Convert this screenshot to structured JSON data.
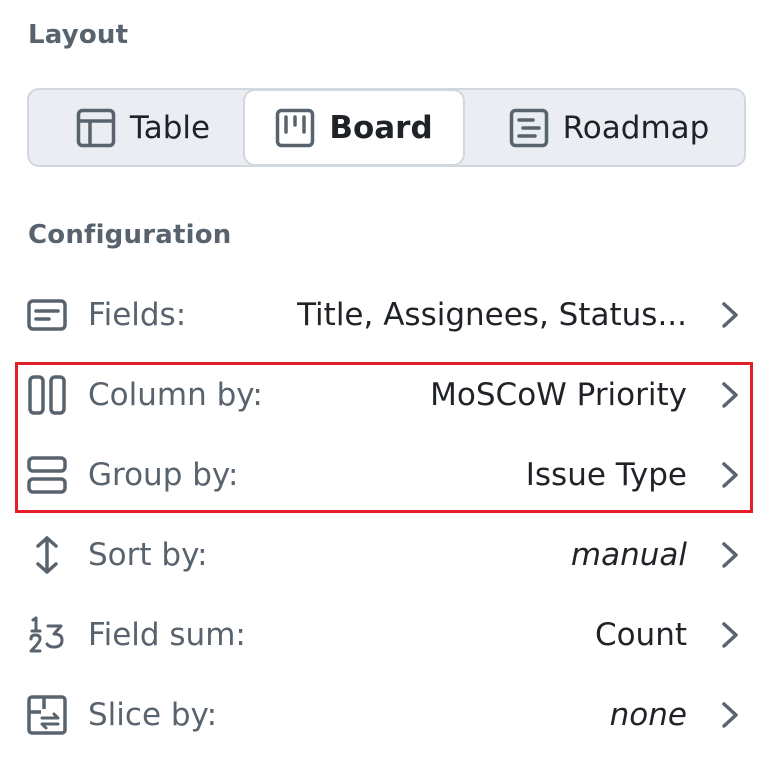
{
  "layout": {
    "title": "Layout",
    "options": [
      {
        "label": "Table",
        "icon": "table-icon",
        "selected": false
      },
      {
        "label": "Board",
        "icon": "board-icon",
        "selected": true
      },
      {
        "label": "Roadmap",
        "icon": "roadmap-icon",
        "selected": false
      }
    ]
  },
  "configuration": {
    "title": "Configuration",
    "rows": [
      {
        "label": "Fields:",
        "value": "Title, Assignees, Status...",
        "icon": "fields-icon"
      },
      {
        "label": "Column by:",
        "value": "MoSCoW Priority",
        "icon": "column-icon"
      },
      {
        "label": "Group by:",
        "value": "Issue Type",
        "icon": "group-icon"
      },
      {
        "label": "Sort by:",
        "value": "manual",
        "icon": "sort-icon"
      },
      {
        "label": "Field sum:",
        "value": "Count",
        "icon": "field-sum-icon"
      },
      {
        "label": "Slice by:",
        "value": "none",
        "icon": "slice-icon"
      }
    ]
  },
  "colors": {
    "highlight": "#e3202a",
    "muted_text": "#59636e",
    "primary_text": "#1f2328",
    "segment_bg": "#eaeef2",
    "border": "#d0d7de"
  }
}
